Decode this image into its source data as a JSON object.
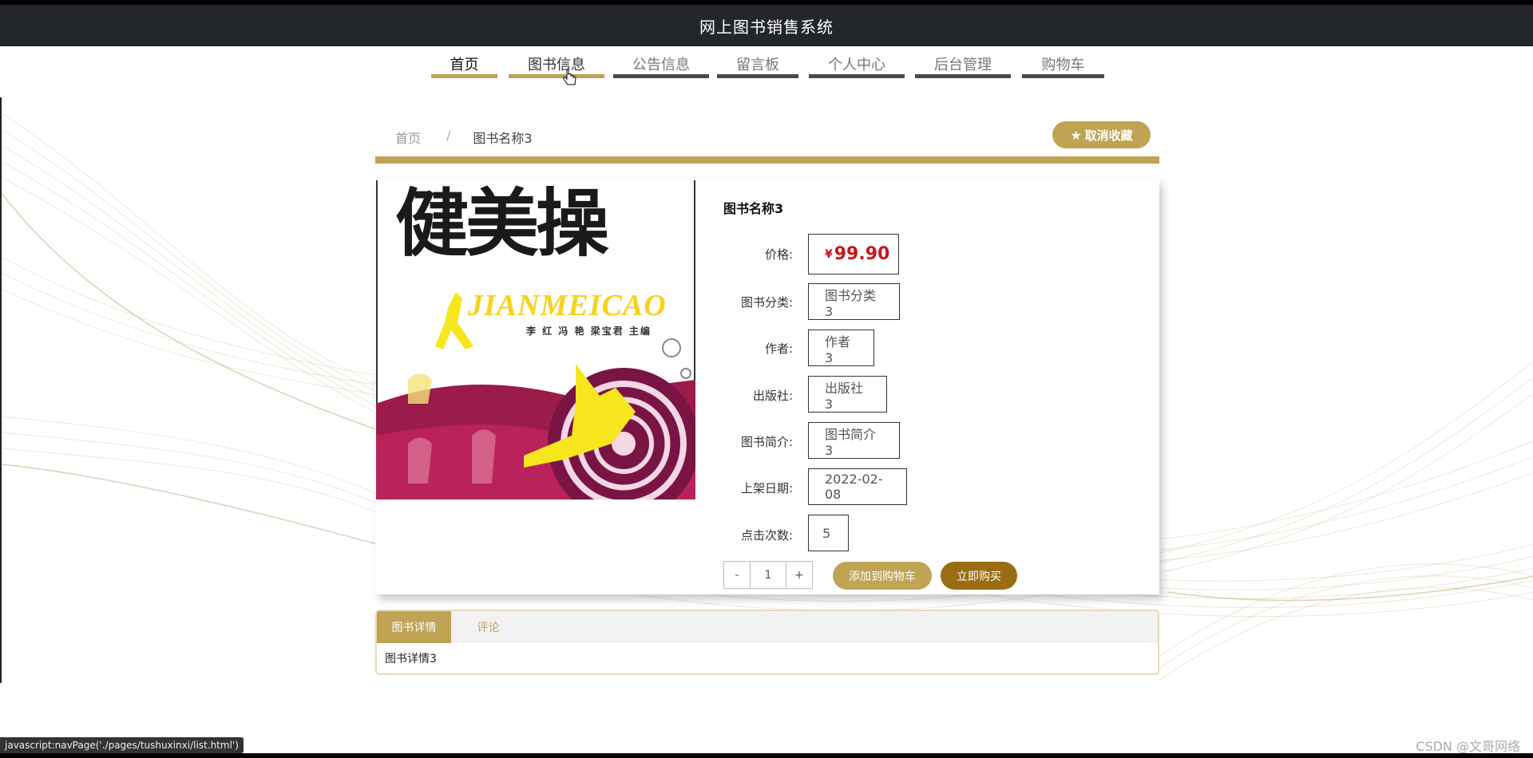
{
  "site": {
    "title": "网上图书销售系统"
  },
  "nav": {
    "items": [
      "首页",
      "图书信息",
      "公告信息",
      "留言板",
      "个人中心",
      "后台管理",
      "购物车"
    ]
  },
  "breadcrumb": {
    "home": "首页",
    "separator": "/",
    "current": "图书名称3"
  },
  "favorite": {
    "label": "取消收藏",
    "icon": "star-icon"
  },
  "cover": {
    "title": "健美操",
    "pinyin": "JIANMEICAO",
    "authors": "李 红 冯 艳 梁宝君 主编"
  },
  "book": {
    "name": "图书名称3",
    "fields": [
      {
        "label": "价格:",
        "value": "99.90",
        "currency": "¥"
      },
      {
        "label": "图书分类:",
        "value": "图书分类3"
      },
      {
        "label": "作者:",
        "value": "作者3"
      },
      {
        "label": "出版社:",
        "value": "出版社3"
      },
      {
        "label": "图书简介:",
        "value": "图书简介3"
      },
      {
        "label": "上架日期:",
        "value": "2022-02-08"
      },
      {
        "label": "点击次数:",
        "value": "5"
      }
    ]
  },
  "purchase": {
    "minus": "-",
    "quantity": "1",
    "plus": "+",
    "add_to_cart": "添加到购物车",
    "buy_now": "立即购买"
  },
  "tabs": {
    "items": [
      "图书详情",
      "评论"
    ],
    "content": "图书详情3"
  },
  "status_bar": {
    "text": "javascript:navPage('./pages/tushuxinxi/list.html')"
  },
  "watermark": {
    "text": "CSDN @文哥网络"
  },
  "colors": {
    "accent": "#c0a353",
    "buy": "#9a6d13",
    "price": "#c8161d",
    "header": "#23262b"
  }
}
